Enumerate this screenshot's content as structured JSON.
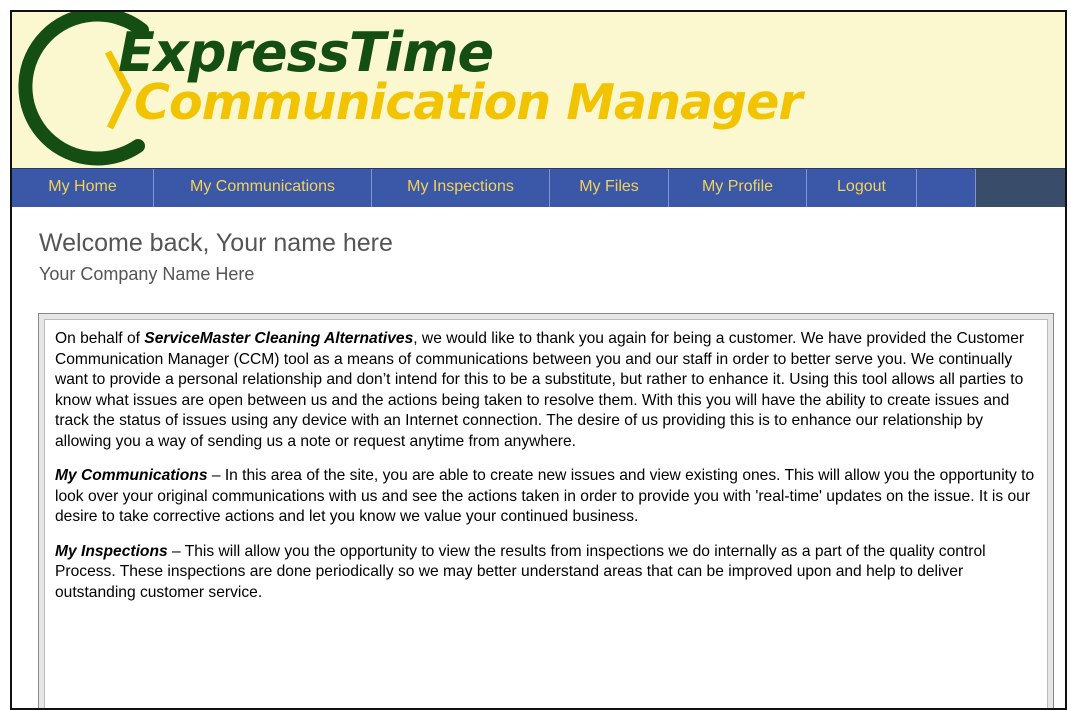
{
  "logo": {
    "line1": "ExpressTime",
    "line2": "Communication Manager"
  },
  "nav": {
    "items": [
      {
        "label": "My Home",
        "name": "nav-my-home"
      },
      {
        "label": "My Communications",
        "name": "nav-my-communications"
      },
      {
        "label": "My Inspections",
        "name": "nav-my-inspections"
      },
      {
        "label": "My Files",
        "name": "nav-my-files"
      },
      {
        "label": "My Profile",
        "name": "nav-my-profile"
      },
      {
        "label": "Logout",
        "name": "nav-logout"
      },
      {
        "label": "",
        "name": "nav-blank"
      }
    ]
  },
  "welcome": {
    "greeting": "Welcome back, Your name here",
    "company": "Your Company Name Here"
  },
  "message": {
    "intro_prefix": "On behalf of ",
    "company_name": "ServiceMaster Cleaning Alternatives",
    "intro_text": ", we would like to thank you again for being a customer. We have provided the Customer Communication Manager (CCM) tool as a means of communications between you and our staff in order to better serve you. We continually want to provide a personal relationship and don’t intend for this to be a substitute, but rather to enhance it. Using this tool allows all parties to know what issues are open between us and the actions being taken to resolve them. With this you will have the ability to create issues and track the status of issues using any device with an Internet connection. The desire of us providing this is to enhance our relationship by allowing you a way of sending us a note or request anytime from anywhere.",
    "comm_title": "My Communications",
    "comm_text": " – In this area of the site, you are able to create new issues and view existing ones. This will allow you the opportunity to look over your original communications with us and see the actions taken in order to provide you with 'real-time' updates on the issue. It is our desire to take corrective actions and let you know we value your continued business.",
    "insp_title": "My Inspections",
    "insp_text": " – This will allow you the opportunity to view the results from inspections we do internally as a part of the quality control Process. These inspections are done periodically so we may better understand areas that can be improved upon and help to deliver outstanding customer service."
  },
  "colors": {
    "header_bg": "#fbf8d0",
    "nav_bg": "#3b57a7",
    "nav_text": "#f1d35a",
    "logo_green": "#144e13",
    "logo_yellow": "#f2c300"
  }
}
